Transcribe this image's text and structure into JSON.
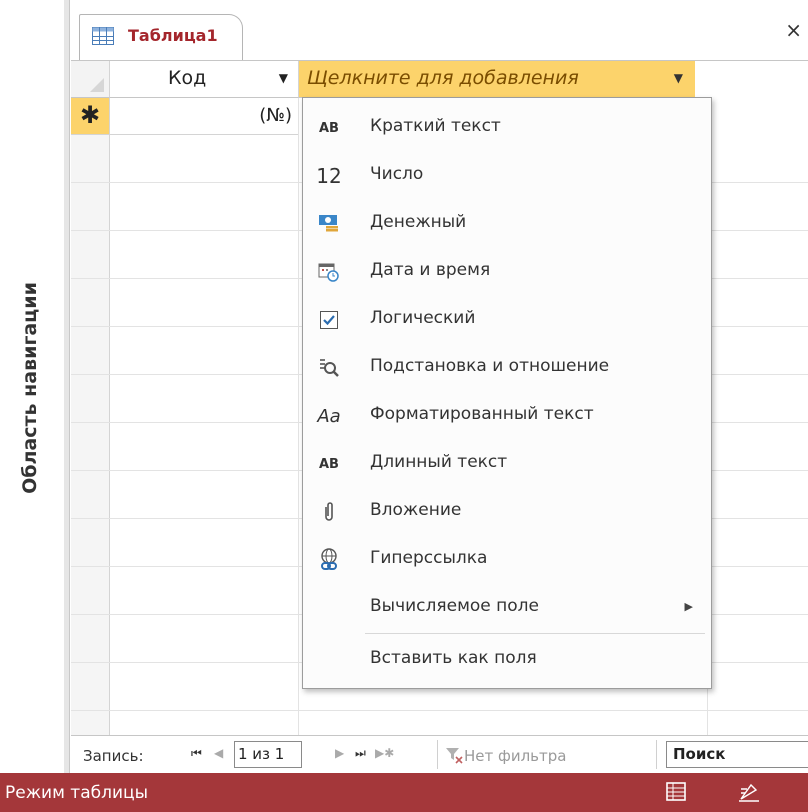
{
  "nav_pane": {
    "title": "Область навигации"
  },
  "tab": {
    "title": "Таблица1",
    "close": "×"
  },
  "grid": {
    "columns": [
      {
        "label": "Код"
      },
      {
        "label": "Щелкните для добавления"
      }
    ],
    "new_row": {
      "marker": "✱",
      "kod_value": "(№)"
    }
  },
  "menu": {
    "items": [
      {
        "icon": "AB",
        "label": "Краткий текст"
      },
      {
        "icon": "12",
        "label": "Число"
      },
      {
        "icon": "currency-icon",
        "label": "Денежный"
      },
      {
        "icon": "calendar-clock-icon",
        "label": "Дата и время"
      },
      {
        "icon": "checkbox-icon",
        "label": "Логический"
      },
      {
        "icon": "lookup-icon",
        "label": "Подстановка и отношение"
      },
      {
        "icon": "Aa",
        "label": "Форматированный текст"
      },
      {
        "icon": "AB",
        "label": "Длинный текст"
      },
      {
        "icon": "paperclip-icon",
        "label": "Вложение"
      },
      {
        "icon": "hyperlink-icon",
        "label": "Гиперссылка"
      },
      {
        "icon": "",
        "label": "Вычисляемое поле"
      },
      {
        "icon": "",
        "label": "Вставить как поля"
      }
    ]
  },
  "record_nav": {
    "label": "Запись:",
    "first": "⏮",
    "prev": "◀",
    "current": "1 из 1",
    "next": "▶",
    "last": "⏭",
    "new": "▶✱",
    "filter": "Нет фильтра",
    "search": "Поиск"
  },
  "status_bar": {
    "mode": "Режим таблицы"
  },
  "colors": {
    "accent": "#a4373a",
    "tab_title": "#a4262c",
    "header_highlight": "#fcd36b"
  }
}
